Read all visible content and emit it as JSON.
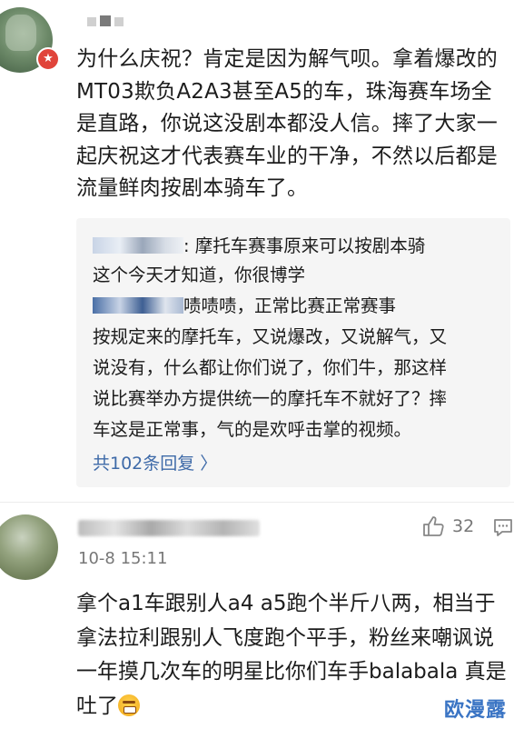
{
  "comment1": {
    "badge": "★",
    "text": "为什么庆祝？肯定是因为解气呗。拿着爆改的MT03欺负A2A3甚至A5的车，珠海赛车场全是直路，你说这没剧本都没人信。摔了大家一起庆祝这才代表赛车业的干净，不然以后都是流量鲜肉按剧本骑车了。"
  },
  "replies": {
    "reply1_prefix": ": 摩托车赛事原来可以按剧本骑",
    "reply1_cont": "这个今天才知道，你很博学",
    "reply2_first": "啧啧啧，正常比赛正常赛事",
    "reply2_lines": [
      "按规定来的摩托车，又说爆改，又说解气，又",
      "说没有，什么都让你们说了，你们牛，那这样",
      "说比赛举办方提供统一的摩托车不就好了？摔",
      "车这是正常事，气的是欢呼击掌的视频。"
    ],
    "more_label": "共102条回复 〉"
  },
  "comment2": {
    "time": "10-8 15:11",
    "likes": "32",
    "text": "拿个a1车跟别人a4 a5跑个半斤八两，相当于拿法拉利跟别人飞度跑个平手，粉丝来嘲讽说一年摸几次车的明星比你们车手balabala 真是吐了"
  },
  "watermark": "欧漫露",
  "colors": {
    "link": "#3e6aa8",
    "badge": "#e0443a",
    "reply_bg": "#f5f5f5"
  }
}
